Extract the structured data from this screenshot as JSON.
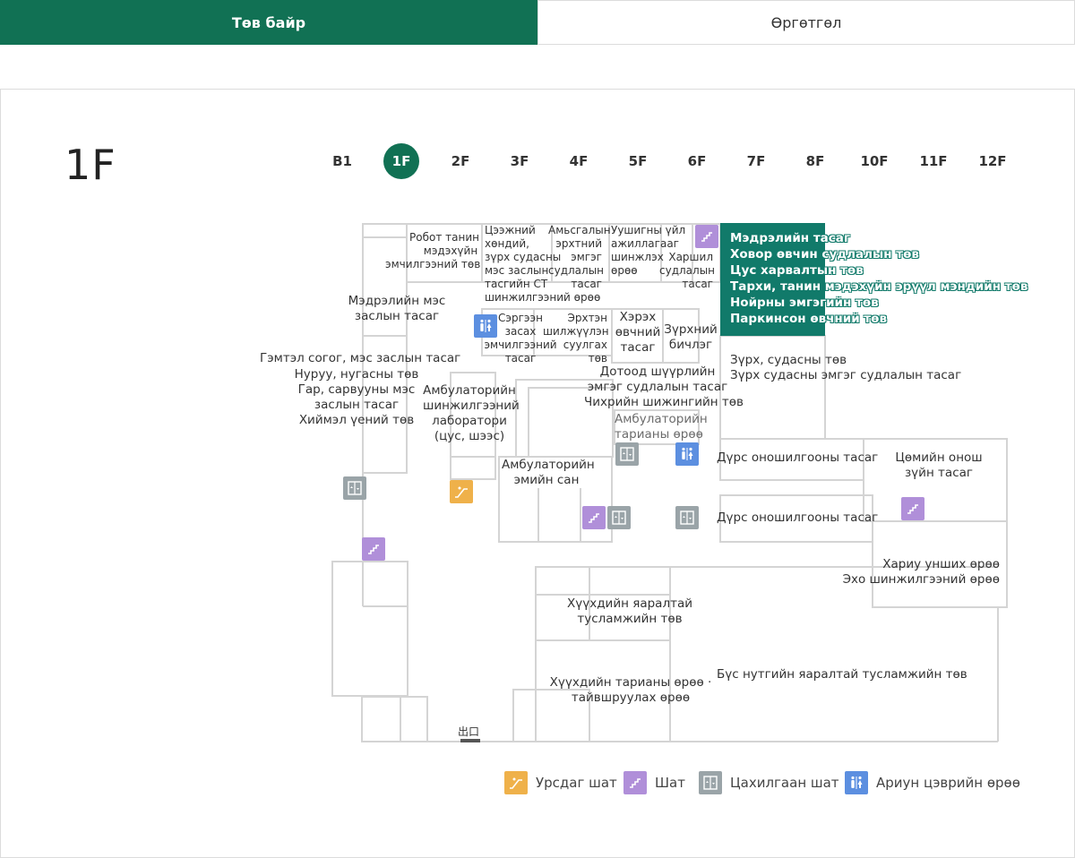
{
  "tabs": [
    {
      "label": "Төв байр",
      "active": true
    },
    {
      "label": "Өргөтгөл",
      "active": false
    }
  ],
  "floor": {
    "current": "1F"
  },
  "floors": [
    "B1",
    "1F",
    "2F",
    "3F",
    "4F",
    "5F",
    "6F",
    "7F",
    "8F",
    "10F",
    "11F",
    "12F"
  ],
  "active_floor": "1F",
  "colors": {
    "brand": "#117154",
    "highlight": "#117a6a",
    "stairs": "#b08fd9",
    "escalator": "#efb14a",
    "elevator": "#9aa4a8",
    "restroom": "#5c8fe0"
  },
  "map": {
    "highlighted_room": [
      "Мэдрэлийн тасаг",
      "Ховор өвчин судлалын төв",
      "Цус харвалтын төв",
      "Тархи, танин мэдэхүйн эрүүл мэндийн төв",
      "Нойрны эмгэгийн төв",
      "Паркинсон өвчний төв"
    ],
    "labels": {
      "robot": [
        "Робот танин",
        "мэдэхүйн",
        "эмчилгээний төв"
      ],
      "chest_ct": [
        "Цээжний",
        "хөндий,",
        "зүрх судасны",
        "мэс заслын",
        "тасгийн СТ",
        "шинжилгээний өрөө"
      ],
      "respiratory": [
        "Амьсгалын",
        "эрхтний",
        "эмгэг",
        "судлалын",
        "тасаг"
      ],
      "lung_test": [
        "Уушигны үйл",
        "ажиллагааг",
        "шинжлэх",
        "өрөө"
      ],
      "allergy": [
        "Харшил",
        "судлалын",
        "тасаг"
      ],
      "neurosurgery": [
        "Мэдрэлийн мэс",
        "заслын тасаг"
      ],
      "rehab": [
        "Сэргээн",
        "засах",
        "эмчилгээний",
        "тасаг"
      ],
      "vascular": [
        "Эрхтэн",
        "шилжүүлэн",
        "суулгах",
        "төв"
      ],
      "cancer": [
        "Хэрэх",
        "өвчний",
        "тасаг"
      ],
      "ecg": [
        "Зүрхний",
        "бичлэг"
      ],
      "trauma": [
        "Гэмтэл согог, мэс заслын тасаг",
        "Нуруу, нугасны төв",
        "Гар, сарвууны мэс",
        "заслын тасаг",
        "Хиймэл үений төв"
      ],
      "lab": [
        "Амбулаторийн",
        "шинжилгээний",
        "лаборатори",
        "(цус, шээс)"
      ],
      "endocrine": [
        "Дотоод шүүрлийн",
        "эмгэг судлалын тасаг",
        "Чихрийн шижингийн төв"
      ],
      "injection": [
        "Амбулаторийн",
        "тарианы өрөө"
      ],
      "cardio": [
        "Зүрх, судасны төв",
        "Зүрх судасны эмгэг судлалын тасаг"
      ],
      "pharmacy": [
        "Амбулаторийн",
        "эмийн сан"
      ],
      "radiology1": [
        "Дүрс оношилгооны тасаг"
      ],
      "nuclear": [
        "Цөмийн онош",
        "зүйн тасаг"
      ],
      "radiology2": [
        "Дүрс оношилгооны тасаг"
      ],
      "reading": [
        "Хариу унших өрөө",
        "Эхо шинжилгээний өрөө"
      ],
      "peds_er": [
        "Хүүхдийн яаралтай",
        "тусламжийн төв"
      ],
      "peds_inj": [
        "Хүүхдийн тарианы өрөө ·",
        "тайвшруулах өрөө"
      ],
      "regional_er": [
        "Бүс нутгийн яаралтай тусламжийн төв"
      ]
    },
    "exit_label": "出口"
  },
  "legend": [
    {
      "label": "Урсдаг шат",
      "icon": "escalator-icon"
    },
    {
      "label": "Шат",
      "icon": "stairs-icon"
    },
    {
      "label": "Цахилгаан шат",
      "icon": "elevator-icon"
    },
    {
      "label": "Ариун цэврийн өрөө",
      "icon": "restroom-icon"
    }
  ]
}
